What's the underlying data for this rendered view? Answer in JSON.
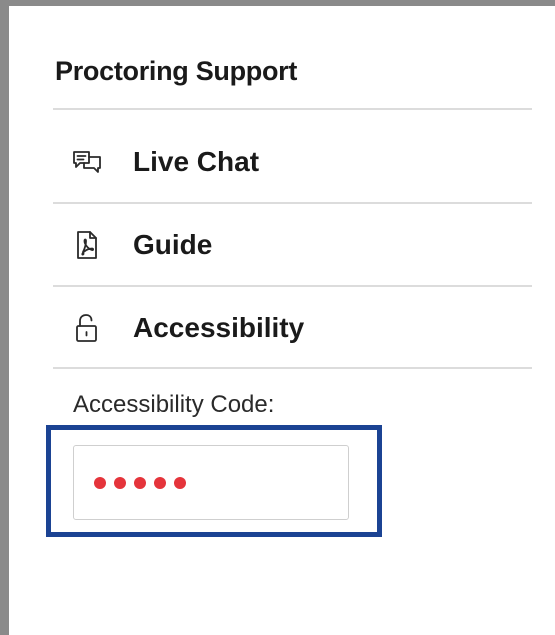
{
  "panel": {
    "title": "Proctoring Support"
  },
  "menu": {
    "items": [
      {
        "label": "Live Chat",
        "icon": "chat-icon"
      },
      {
        "label": "Guide",
        "icon": "pdf-icon"
      },
      {
        "label": "Accessibility",
        "icon": "unlock-icon"
      }
    ]
  },
  "accessibility_code": {
    "label": "Accessibility Code:",
    "masked_length": 5,
    "dot_color": "#e5343b",
    "focus_color": "#1b4393"
  }
}
